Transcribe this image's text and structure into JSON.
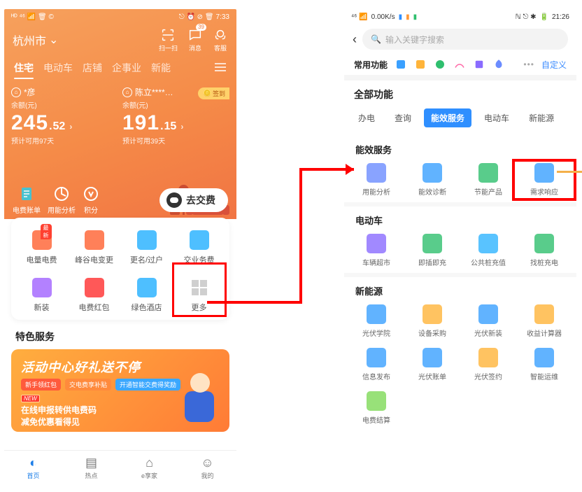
{
  "left": {
    "status": {
      "time": "7:33",
      "signals": "⎋ ⏰ ⊘ 🗑",
      "net": "ᴴᴰ ⁴⁶ 📶 🗑 ©"
    },
    "location": "杭州市",
    "headerIcons": {
      "scan": "扫一扫",
      "msg": "消息",
      "msgBadge": "39",
      "service": "客服"
    },
    "topTabs": [
      "住宅",
      "电动车",
      "店铺",
      "企事业",
      "新能"
    ],
    "activeTab": 0,
    "accounts": [
      {
        "name": "*彦",
        "balLabel": "余额(元)",
        "int": "245",
        "dec": "52",
        "days": "预计可用97天"
      },
      {
        "name": "陈立****…",
        "balLabel": "余额(元)",
        "int": "191",
        "dec": "15",
        "days": "预计可用39天",
        "sign": "签到"
      }
    ],
    "actionRow": {
      "bill": "电费账单",
      "usage": "用能分析",
      "points": "积分",
      "pay": "去交费"
    },
    "grid": [
      {
        "label": "电量电费",
        "tag": "最新",
        "color": "#ff6a3c"
      },
      {
        "label": "峰谷电变更",
        "color": "#ff6a3c"
      },
      {
        "label": "更名/过户",
        "color": "#2fb4ff"
      },
      {
        "label": "交业务费",
        "color": "#2fb4ff"
      },
      {
        "label": "新装",
        "color": "#a66bff"
      },
      {
        "label": "电费红包",
        "color": "#ff3b3b"
      },
      {
        "label": "绿色酒店",
        "color": "#2fb4ff"
      },
      {
        "label": "更多",
        "color": "#cfcfcf"
      }
    ],
    "specialTitle": "特色服务",
    "promo": {
      "title": "活动中心好礼送不停",
      "chips": [
        "新手领红包",
        "交电费享补贴",
        "开通智能交费得奖励"
      ],
      "new": "NEW",
      "line1": "在线申报转供电费码",
      "line2": "减免优惠看得见"
    },
    "tabbar": [
      {
        "l": "首页"
      },
      {
        "l": "热点"
      },
      {
        "l": "e享家"
      },
      {
        "l": "我的"
      }
    ]
  },
  "right": {
    "status": {
      "net": "0.00K/s",
      "time": "21:26",
      "left": "⁴⁶ 📶",
      "icons": "🟦🟧🟩  N ⎋ ⏱ ✱"
    },
    "searchPlaceholder": "输入关键字搜索",
    "favLabel": "常用功能",
    "favCustom": "自定义",
    "allLabel": "全部功能",
    "catTabs": [
      "办电",
      "查询",
      "能效服务",
      "电动车",
      "新能源"
    ],
    "catActive": 2,
    "sections": [
      {
        "title": "能效服务",
        "items": [
          {
            "l": "用能分析",
            "c": "#6b8cff"
          },
          {
            "l": "能效诊断",
            "c": "#3aa0ff"
          },
          {
            "l": "节能产品",
            "c": "#2fbf6e"
          },
          {
            "l": "需求响应",
            "c": "#3aa0ff",
            "hl": true
          }
        ]
      },
      {
        "title": "电动车",
        "items": [
          {
            "l": "车辆超市",
            "c": "#8a6bff"
          },
          {
            "l": "即插即充",
            "c": "#2fbf6e"
          },
          {
            "l": "公共桩充值",
            "c": "#2fb4ff"
          },
          {
            "l": "找桩充电",
            "c": "#2fbf6e"
          }
        ]
      },
      {
        "title": "新能源",
        "items": [
          {
            "l": "光伏学院",
            "c": "#3aa0ff"
          },
          {
            "l": "设备采购",
            "c": "#ffb43a"
          },
          {
            "l": "光伏新装",
            "c": "#3aa0ff"
          },
          {
            "l": "收益计算器",
            "c": "#ffb43a"
          },
          {
            "l": "信息发布",
            "c": "#3aa0ff"
          },
          {
            "l": "光伏账单",
            "c": "#3aa0ff"
          },
          {
            "l": "光伏签约",
            "c": "#ffb43a"
          },
          {
            "l": "智能运维",
            "c": "#3aa0ff"
          },
          {
            "l": "电费结算",
            "c": "#7ed957"
          }
        ]
      }
    ]
  }
}
